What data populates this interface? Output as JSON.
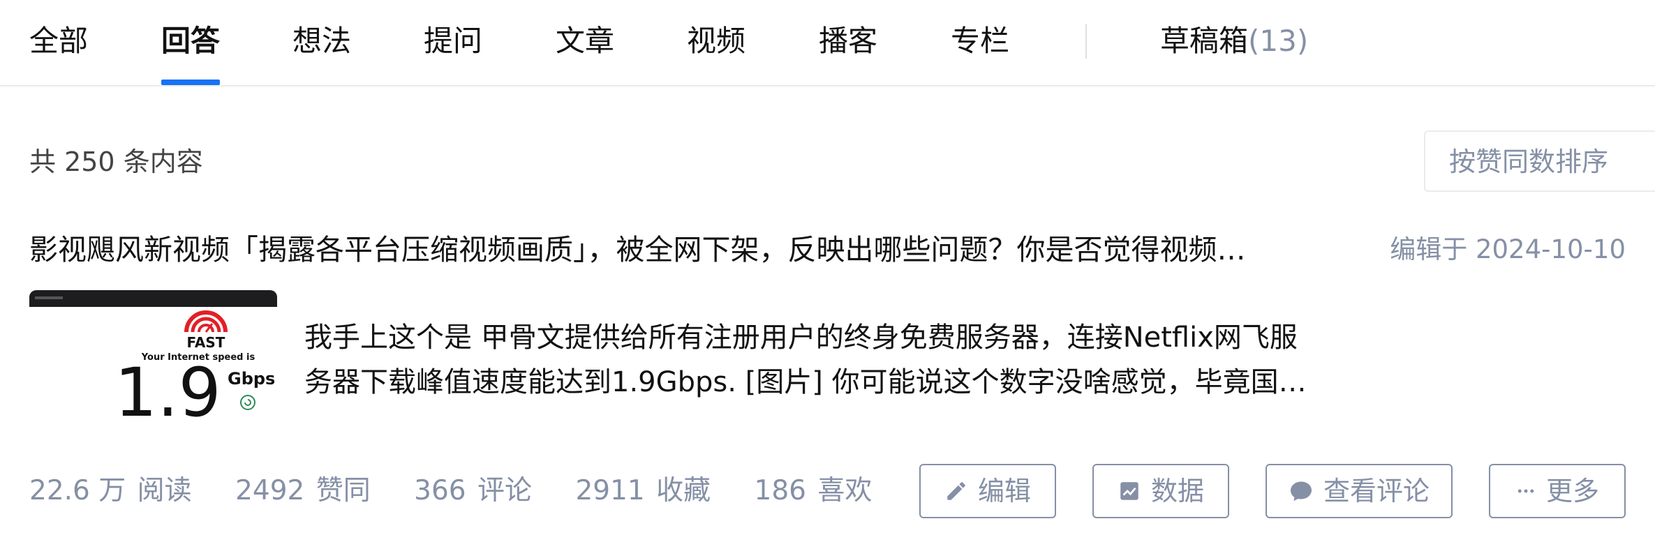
{
  "tabs": [
    {
      "label": "全部"
    },
    {
      "label": "回答"
    },
    {
      "label": "想法"
    },
    {
      "label": "提问"
    },
    {
      "label": "文章"
    },
    {
      "label": "视频"
    },
    {
      "label": "播客"
    },
    {
      "label": "专栏"
    }
  ],
  "active_tab": "回答",
  "drafts": {
    "label": "草稿箱",
    "count": "(13)"
  },
  "summary": {
    "total_text": "共 250 条内容"
  },
  "sort": {
    "selected": "按赞同数排序"
  },
  "answer": {
    "title": "影视飓风新视频「揭露各平台压缩视频画质」，被全网下架，反映出哪些问题？你是否觉得视频…",
    "edited": "编辑于 2024-10-10",
    "thumbnail": {
      "brand": "FAST",
      "caption": "Your Internet speed is",
      "value": "1.9",
      "unit": "Gbps"
    },
    "excerpt": "我手上这个是 甲骨文提供给所有注册用户的终身免费服务器，连接Netflix网飞服务器下载峰值速度能达到1.9Gbps. [图片] 你可能说这个数字没啥感觉，毕竟国内…",
    "stats": {
      "reads_value": "22.6 万",
      "reads_label": "阅读",
      "likes_value": "2492",
      "likes_label": "赞同",
      "comments_value": "366",
      "comments_label": "评论",
      "favorites_value": "2911",
      "favorites_label": "收藏",
      "loves_value": "186",
      "loves_label": "喜欢"
    },
    "actions": {
      "edit": "编辑",
      "data": "数据",
      "view_comments": "查看评论",
      "more": "更多"
    }
  },
  "colors": {
    "accent": "#1772f6",
    "muted": "#8590a6",
    "fast_red": "#e21f26"
  },
  "icons": {
    "edit": "pencil-icon",
    "data": "chart-icon",
    "comments": "comment-bubble-icon",
    "more": "ellipsis-icon",
    "thumb_logo": "speedometer-icon",
    "thumb_refresh": "refresh-icon"
  }
}
